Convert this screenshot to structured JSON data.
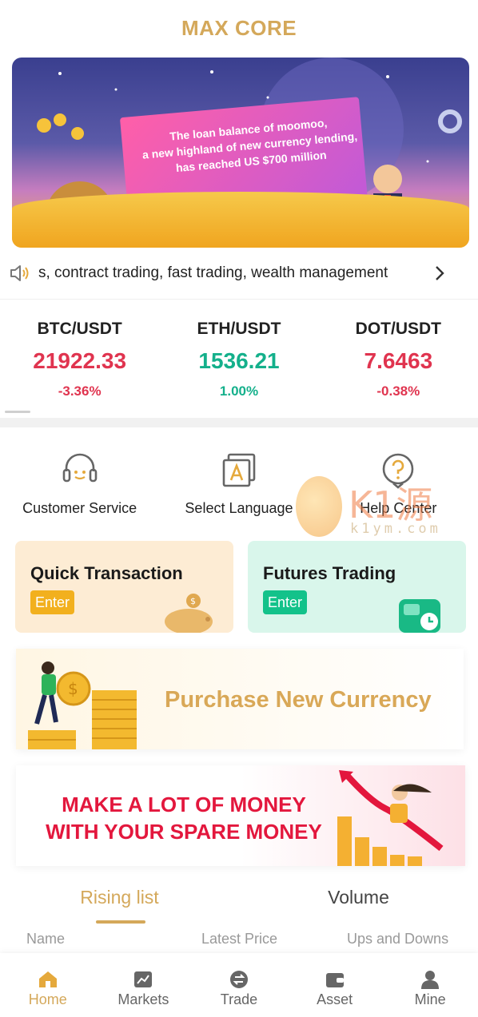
{
  "header": {
    "title": "MAX CORE"
  },
  "banner": {
    "headline_line1": "The loan balance of moomoo,",
    "headline_line2": "a new highland of new currency lending,",
    "headline_line3": "has reached US $700 million"
  },
  "notice": {
    "text": "s, contract trading, fast trading, wealth management"
  },
  "tickers": [
    {
      "pair": "BTC/USDT",
      "price": "21922.33",
      "change": "-3.36%",
      "trend": "down"
    },
    {
      "pair": "ETH/USDT",
      "price": "1536.21",
      "change": "1.00%",
      "trend": "up"
    },
    {
      "pair": "DOT/USDT",
      "price": "7.6463",
      "change": "-0.38%",
      "trend": "down"
    }
  ],
  "quick_links": [
    {
      "label": "Customer Service",
      "icon": "headset-icon"
    },
    {
      "label": "Select Language",
      "icon": "language-icon"
    },
    {
      "label": "Help Center",
      "icon": "help-icon"
    }
  ],
  "watermark": {
    "title": "K1源码",
    "sub": "k1ym.com"
  },
  "cards": {
    "quick": {
      "title": "Quick Transaction",
      "enter": "Enter"
    },
    "futures": {
      "title": "Futures Trading",
      "enter": "Enter"
    }
  },
  "purchase": {
    "label": "Purchase New Currency"
  },
  "money_banner": {
    "line1": "MAKE A LOT OF MONEY",
    "line2": "WITH YOUR SPARE MONEY"
  },
  "list": {
    "tabs": [
      "Rising list",
      "Volume"
    ],
    "columns": [
      "Name",
      "Latest Price",
      "Ups and Downs"
    ]
  },
  "nav": [
    {
      "label": "Home",
      "icon": "home-icon",
      "active": true
    },
    {
      "label": "Markets",
      "icon": "markets-icon",
      "active": false
    },
    {
      "label": "Trade",
      "icon": "trade-icon",
      "active": false
    },
    {
      "label": "Asset",
      "icon": "wallet-icon",
      "active": false
    },
    {
      "label": "Mine",
      "icon": "user-icon",
      "active": false
    }
  ],
  "colors": {
    "accent": "#d4a85a",
    "up": "#14b08b",
    "down": "#e0344f"
  }
}
